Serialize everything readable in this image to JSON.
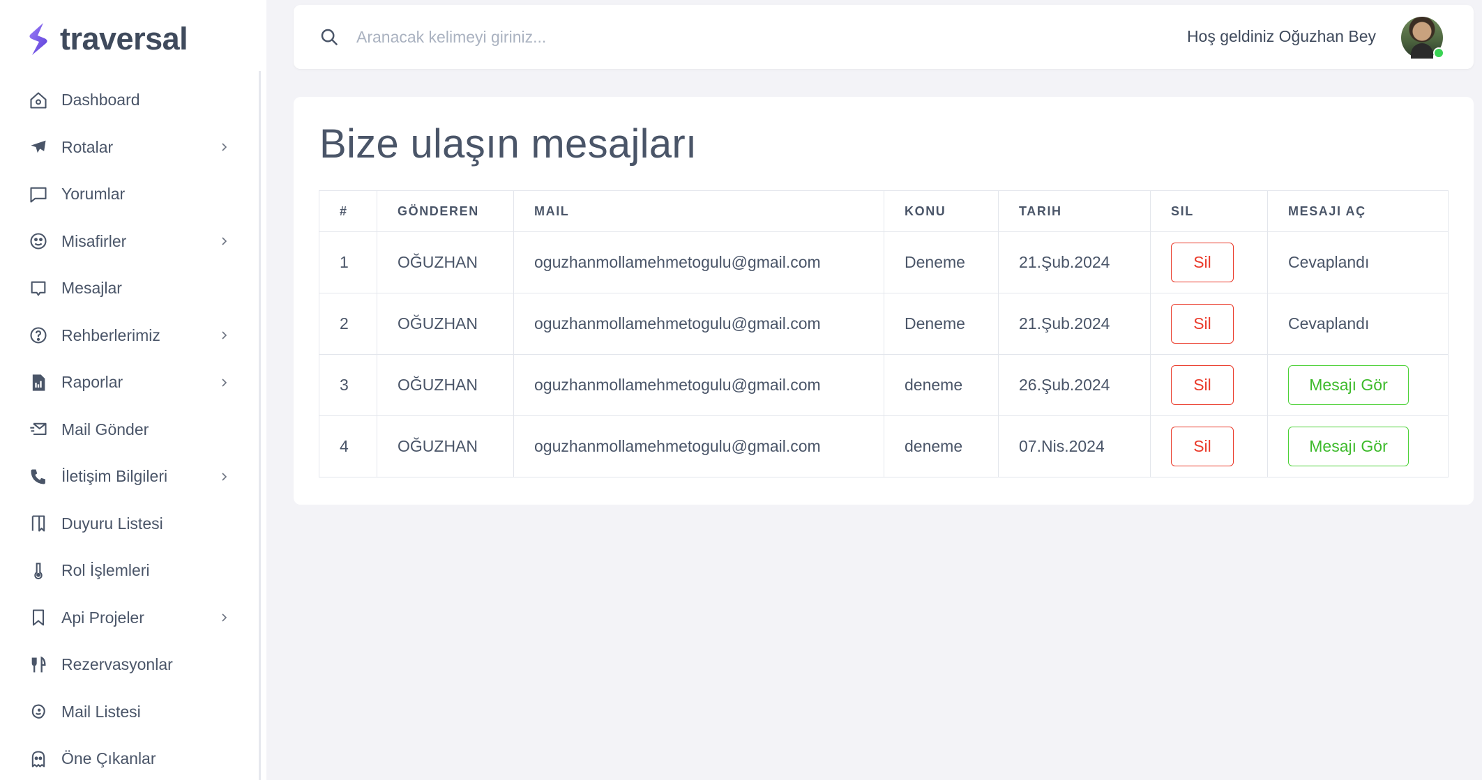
{
  "brand": {
    "name": "traversal"
  },
  "sidebar": {
    "items": [
      {
        "label": "Dashboard",
        "icon": "home-icon",
        "has_children": false
      },
      {
        "label": "Rotalar",
        "icon": "plane-icon",
        "has_children": true
      },
      {
        "label": "Yorumlar",
        "icon": "comment-icon",
        "has_children": false
      },
      {
        "label": "Misafirler",
        "icon": "smile-icon",
        "has_children": true
      },
      {
        "label": "Mesajlar",
        "icon": "message-icon",
        "has_children": false
      },
      {
        "label": "Rehberlerimiz",
        "icon": "help-circle-icon",
        "has_children": true
      },
      {
        "label": "Raporlar",
        "icon": "report-icon",
        "has_children": true
      },
      {
        "label": "Mail Gönder",
        "icon": "mail-send-icon",
        "has_children": false
      },
      {
        "label": "İletişim Bilgileri",
        "icon": "phone-icon",
        "has_children": true
      },
      {
        "label": "Duyuru Listesi",
        "icon": "map-icon",
        "has_children": false
      },
      {
        "label": "Rol İşlemleri",
        "icon": "thermometer-icon",
        "has_children": false
      },
      {
        "label": "Api Projeler",
        "icon": "bookmark-icon",
        "has_children": true
      },
      {
        "label": "Rezervasyonlar",
        "icon": "utensils-icon",
        "has_children": false
      },
      {
        "label": "Mail Listesi",
        "icon": "mailchimp-icon",
        "has_children": false
      },
      {
        "label": "Öne Çıkanlar",
        "icon": "ghost-icon",
        "has_children": false
      }
    ]
  },
  "topbar": {
    "search_placeholder": "Aranacak kelimeyi giriniz...",
    "welcome_text": "Hoş geldiniz Oğuzhan Bey"
  },
  "main": {
    "title": "Bize ulaşın mesajları",
    "table": {
      "headers": [
        "#",
        "GÖNDEREN",
        "MAIL",
        "KONU",
        "TARIH",
        "SIL",
        "MESAJI AÇ"
      ],
      "rows": [
        {
          "num": "1",
          "sender": "OĞUZHAN",
          "mail": "oguzhanmollamehmetogulu@gmail.com",
          "konu": "Deneme",
          "tarih": "21.Şub.2024",
          "sil": "Sil",
          "status": "Cevaplandı",
          "action": ""
        },
        {
          "num": "2",
          "sender": "OĞUZHAN",
          "mail": "oguzhanmollamehmetogulu@gmail.com",
          "konu": "Deneme",
          "tarih": "21.Şub.2024",
          "sil": "Sil",
          "status": "Cevaplandı",
          "action": ""
        },
        {
          "num": "3",
          "sender": "OĞUZHAN",
          "mail": "oguzhanmollamehmetogulu@gmail.com",
          "konu": "deneme",
          "tarih": "26.Şub.2024",
          "sil": "Sil",
          "status": "",
          "action": "Mesajı Gör"
        },
        {
          "num": "4",
          "sender": "OĞUZHAN",
          "mail": "oguzhanmollamehmetogulu@gmail.com",
          "konu": "deneme",
          "tarih": "07.Nis.2024",
          "sil": "Sil",
          "status": "",
          "action": "Mesajı Gör"
        }
      ]
    }
  },
  "colors": {
    "accent": "#7c5cf0",
    "danger": "#ea3a2a",
    "success": "#4cd137",
    "background": "#f3f3f7",
    "text": "#4a5568"
  }
}
